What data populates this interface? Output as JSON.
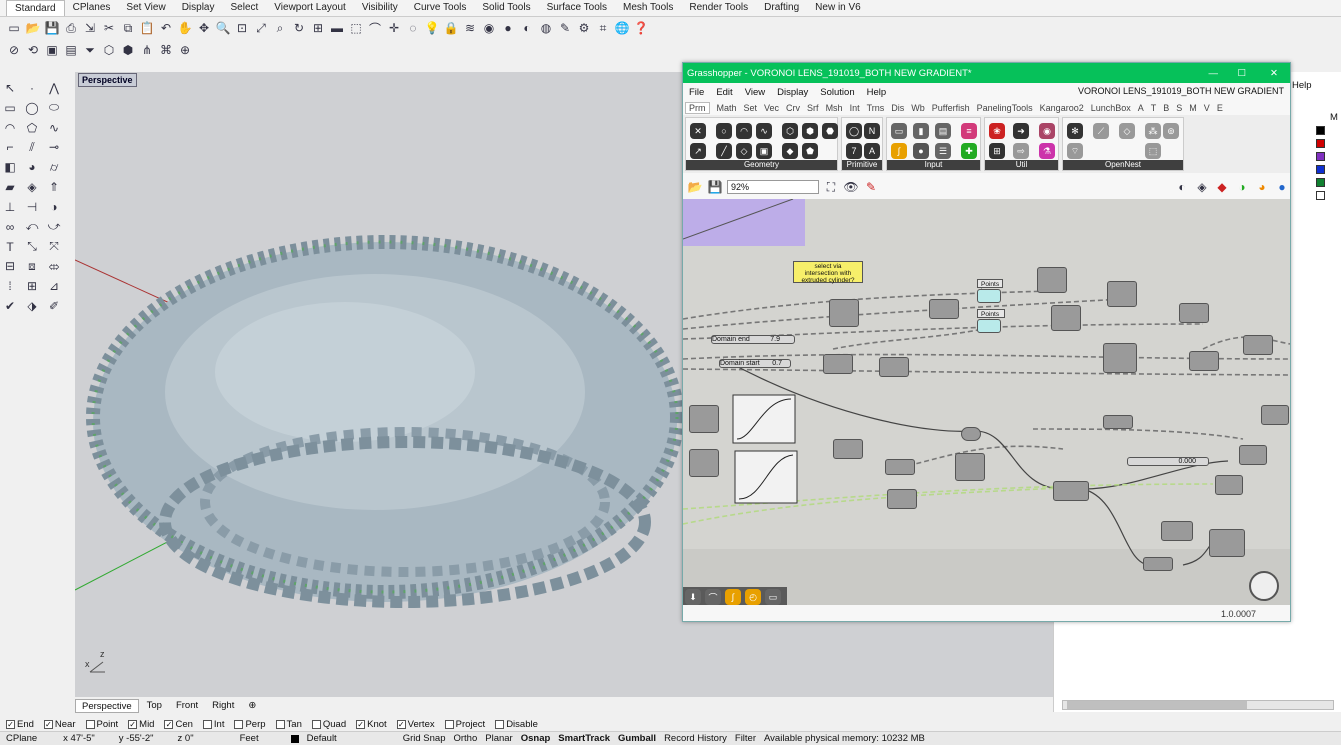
{
  "rhino": {
    "tabs": [
      "Standard",
      "CPlanes",
      "Set View",
      "Display",
      "Select",
      "Viewport Layout",
      "Visibility",
      "Curve Tools",
      "Solid Tools",
      "Surface Tools",
      "Mesh Tools",
      "Render Tools",
      "Drafting",
      "New in V6"
    ],
    "active_tab": "Standard",
    "viewport_label": "Perspective",
    "view_tabs": [
      "Perspective",
      "Top",
      "Front",
      "Right"
    ],
    "osnaps": [
      {
        "label": "End",
        "checked": true
      },
      {
        "label": "Near",
        "checked": true
      },
      {
        "label": "Point",
        "checked": false
      },
      {
        "label": "Mid",
        "checked": true
      },
      {
        "label": "Cen",
        "checked": true
      },
      {
        "label": "Int",
        "checked": false
      },
      {
        "label": "Perp",
        "checked": false
      },
      {
        "label": "Tan",
        "checked": false
      },
      {
        "label": "Quad",
        "checked": false
      },
      {
        "label": "Knot",
        "checked": true
      },
      {
        "label": "Vertex",
        "checked": true
      },
      {
        "label": "Project",
        "checked": false
      },
      {
        "label": "Disable",
        "checked": false
      }
    ],
    "status": {
      "cplane": "CPlane",
      "x": "x 47'-5\"",
      "y": "y -55'-2\"",
      "z": "z 0\"",
      "units": "Feet",
      "layer": "Default",
      "grid_snap": "Grid Snap",
      "ortho": "Ortho",
      "planar": "Planar",
      "osnap": "Osnap",
      "smarttrack": "SmartTrack",
      "gumball": "Gumball",
      "record": "Record History",
      "filter": "Filter",
      "memory": "Available physical memory: 10232 MB"
    },
    "right_panel_help": "Help",
    "right_panel_m": "M",
    "layer_colors": [
      "#000000",
      "#d00000",
      "#8030c0",
      "#1030d0",
      "#108030",
      "#ffffff"
    ]
  },
  "grasshopper": {
    "title": "Grasshopper - VORONOI LENS_191019_BOTH NEW GRADIENT*",
    "doc_name": "VORONOI LENS_191019_BOTH NEW GRADIENT",
    "menu": [
      "File",
      "Edit",
      "View",
      "Display",
      "Solution",
      "Help"
    ],
    "ribbon": [
      "Prm",
      "Math",
      "Set",
      "Vec",
      "Crv",
      "Srf",
      "Msh",
      "Int",
      "Trns",
      "Dis",
      "Wb",
      "Pufferfish",
      "PanelingTools",
      "Kangaroo2",
      "LunchBox",
      "A",
      "T",
      "B",
      "S",
      "M",
      "V",
      "E"
    ],
    "groups": [
      "Geometry",
      "Primitive",
      "Input",
      "Util",
      "OpenNest"
    ],
    "zoom": "92%",
    "version": "1.0.0007",
    "note": "select via intersection with extruded cylinder?",
    "panels": {
      "points_in": "Points in",
      "points_out": "Points out",
      "domain_end": "Domain end",
      "domain_end_val": "7.9",
      "domain_start": "Domain start",
      "domain_start_val": "0.7",
      "slider_val": "0.000"
    }
  }
}
